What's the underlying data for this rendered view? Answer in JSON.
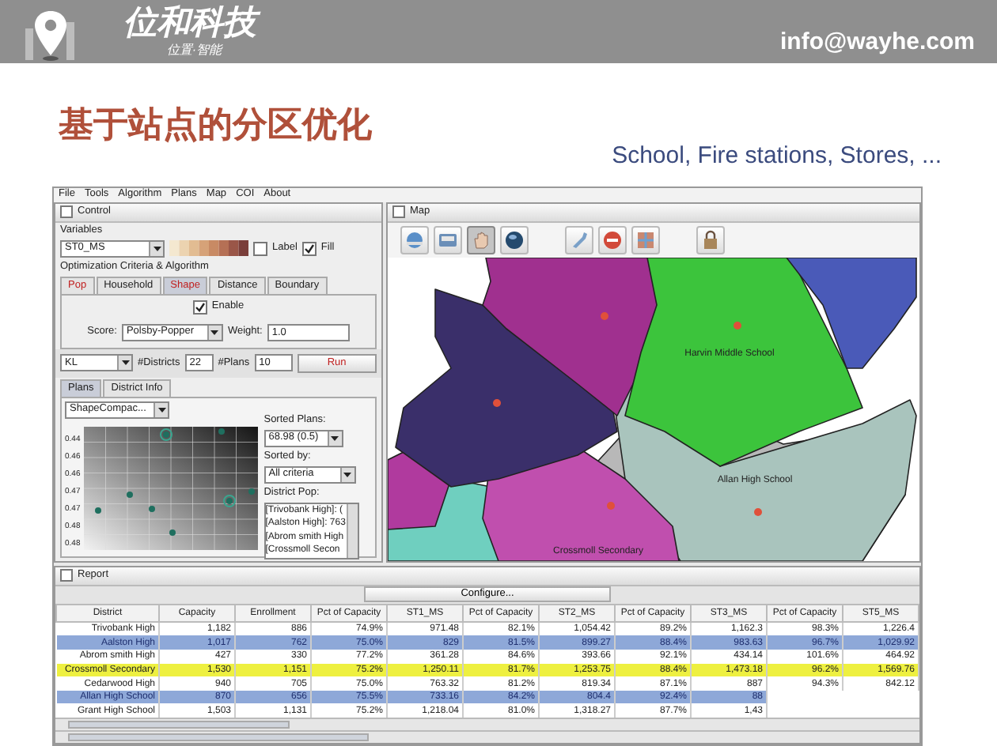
{
  "header": {
    "brand": "位和科技",
    "tagline": "位置·智能",
    "email": "info@wayhe.com"
  },
  "slide": {
    "title": "基于站点的分区优化",
    "subtitle": "School, Fire stations, Stores, ..."
  },
  "app": {
    "menu": [
      "File",
      "Tools",
      "Algorithm",
      "Plans",
      "Map",
      "COI",
      "About"
    ],
    "control": {
      "title": "Control",
      "title_checked": false,
      "variables_label": "Variables",
      "variable": "ST0_MS",
      "label_option": {
        "label": "Label",
        "checked": false
      },
      "fill_option": {
        "label": "Fill",
        "checked": true
      },
      "criteria_label": "Optimization Criteria & Algorithm",
      "criteria_tabs": [
        {
          "label": "Pop",
          "selected": false,
          "emphasis": true
        },
        {
          "label": "Household",
          "selected": false,
          "emphasis": false
        },
        {
          "label": "Shape",
          "selected": true,
          "emphasis": true
        },
        {
          "label": "Distance",
          "selected": false,
          "emphasis": false
        },
        {
          "label": "Boundary",
          "selected": false,
          "emphasis": false
        }
      ],
      "enable": {
        "label": "Enable",
        "checked": true
      },
      "score_label": "Score:",
      "score": "Polsby-Popper",
      "weight_label": "Weight:",
      "weight": "1.0",
      "algorithm": "KL",
      "districts_label": "#Districts",
      "districts": "22",
      "plans_label": "#Plans",
      "plans": "10",
      "run": "Run",
      "result_tabs": [
        {
          "label": "Plans",
          "selected": true
        },
        {
          "label": "District Info",
          "selected": false
        }
      ],
      "metric": "ShapeCompac...",
      "plot_ticks": [
        "0.44",
        "0.46",
        "0.46",
        "0.47",
        "0.47",
        "0.48",
        "0.48"
      ],
      "sorted_plans_label": "Sorted Plans:",
      "sorted_plan": "68.98 (0.5)",
      "sorted_by_label": "Sorted by:",
      "sorted_by": "All criteria",
      "district_pop_label": "District Pop:",
      "district_pop": [
        "[Trivobank High]: (",
        "[Aalston High]: 763",
        "[Abrom smith High",
        "[Crossmoll Secon"
      ]
    },
    "map": {
      "title": "Map",
      "title_checked": false,
      "tools": [
        {
          "kind": "zoom-in",
          "selected": false
        },
        {
          "kind": "zoom-out",
          "selected": false
        },
        {
          "kind": "pan",
          "selected": true
        },
        {
          "kind": "globe",
          "selected": false
        },
        {
          "kind": "wrench",
          "selected": false
        },
        {
          "kind": "stop",
          "selected": false
        },
        {
          "kind": "grid",
          "selected": false
        },
        {
          "kind": "lock",
          "selected": false
        }
      ],
      "labels": [
        "Harvin Middle School",
        "Allan High School",
        "Crossmoll Secondary"
      ]
    },
    "report": {
      "title": "Report",
      "title_checked": false,
      "configure": "Configure...",
      "columns": [
        "District",
        "Capacity",
        "Enrollment",
        "Pct of Capacity",
        "ST1_MS",
        "Pct of Capacity",
        "ST2_MS",
        "Pct of Capacity",
        "ST3_MS",
        "Pct of Capacity",
        "ST5_MS"
      ],
      "rows": [
        {
          "cells": [
            "Trivobank High",
            "1,182",
            "886",
            "74.9%",
            "971.48",
            "82.1%",
            "1,054.42",
            "89.2%",
            "1,162.3",
            "98.3%",
            "1,226.4"
          ],
          "selected": false,
          "highlighted": false
        },
        {
          "cells": [
            "Aalston High",
            "1,017",
            "762",
            "75.0%",
            "829",
            "81.5%",
            "899.27",
            "88.4%",
            "983.63",
            "96.7%",
            "1,029.92"
          ],
          "selected": true,
          "highlighted": false
        },
        {
          "cells": [
            "Abrom smith High",
            "427",
            "330",
            "77.2%",
            "361.28",
            "84.6%",
            "393.66",
            "92.1%",
            "434.14",
            "101.6%",
            "464.92"
          ],
          "selected": false,
          "highlighted": false
        },
        {
          "cells": [
            "Crossmoll Secondary",
            "1,530",
            "1,151",
            "75.2%",
            "1,250.11",
            "81.7%",
            "1,253.75",
            "88.4%",
            "1,473.18",
            "96.2%",
            "1,569.76"
          ],
          "selected": false,
          "highlighted": true
        },
        {
          "cells": [
            "Cedarwood High",
            "940",
            "705",
            "75.0%",
            "763.32",
            "81.2%",
            "819.34",
            "87.1%",
            "887",
            "94.3%",
            "842.12"
          ],
          "selected": false,
          "highlighted": false
        },
        {
          "cells": [
            "Allan High School",
            "870",
            "656",
            "75.5%",
            "733.16",
            "84.2%",
            "804.4",
            "92.4%",
            "88"
          ],
          "selected": true,
          "highlighted": false
        },
        {
          "cells": [
            "Grant High School",
            "1,503",
            "1,131",
            "75.2%",
            "1,218.04",
            "81.0%",
            "1,318.27",
            "87.7%",
            "1,43"
          ],
          "selected": false,
          "highlighted": false
        }
      ]
    }
  }
}
